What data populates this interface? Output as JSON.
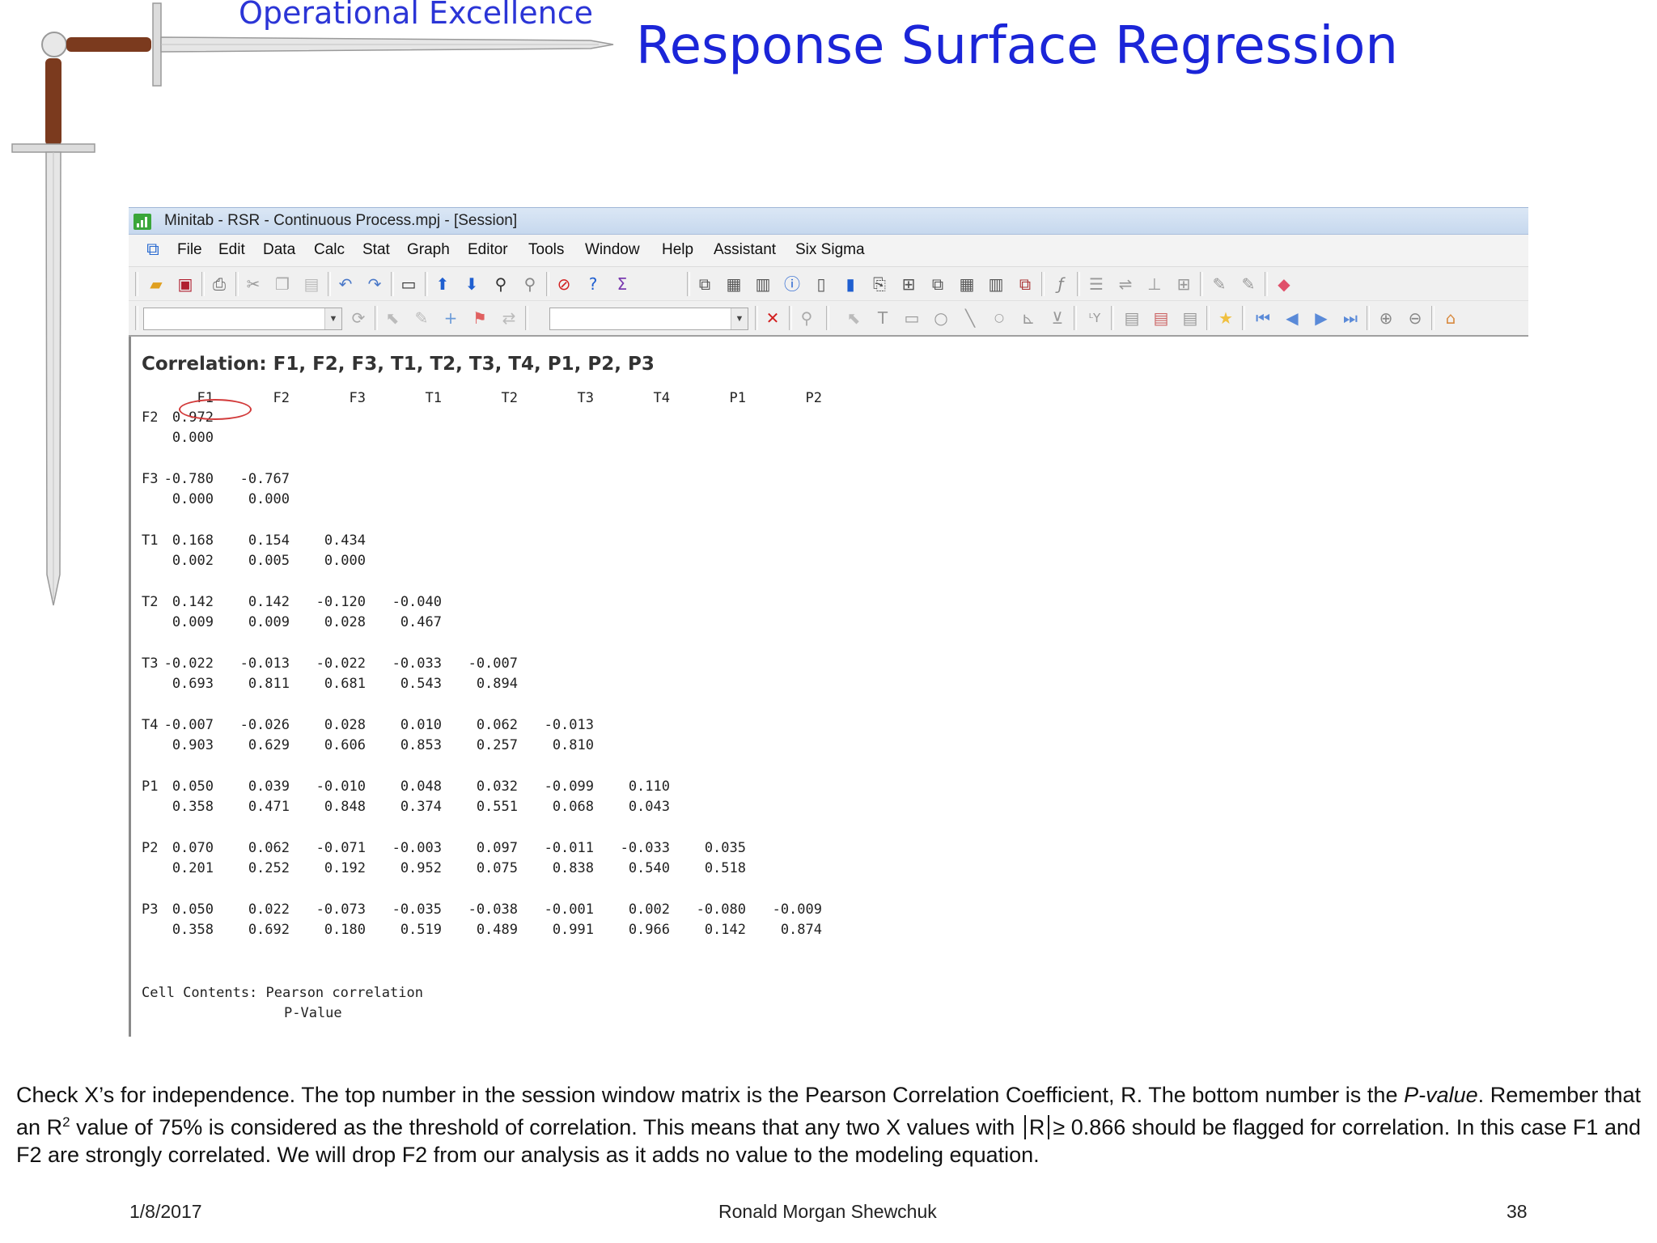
{
  "header": {
    "brand": "Operational Excellence",
    "title": "Response Surface Regression"
  },
  "window": {
    "title": "Minitab - RSR - Continuous Process.mpj - [Session]",
    "menu": [
      "File",
      "Edit",
      "Data",
      "Calc",
      "Stat",
      "Graph",
      "Editor",
      "Tools",
      "Window",
      "Help",
      "Assistant",
      "Six Sigma"
    ]
  },
  "session": {
    "heading": "Correlation: F1, F2, F3, T1, T2, T3, T4, P1, P2, P3",
    "columns": [
      "F1",
      "F2",
      "F3",
      "T1",
      "T2",
      "T3",
      "T4",
      "P1",
      "P2"
    ],
    "rows": [
      {
        "label": "F2",
        "r": [
          "0.972"
        ],
        "p": [
          "0.000"
        ]
      },
      {
        "label": "F3",
        "r": [
          "-0.780",
          "-0.767"
        ],
        "p": [
          "0.000",
          "0.000"
        ]
      },
      {
        "label": "T1",
        "r": [
          "0.168",
          "0.154",
          "0.434"
        ],
        "p": [
          "0.002",
          "0.005",
          "0.000"
        ]
      },
      {
        "label": "T2",
        "r": [
          "0.142",
          "0.142",
          "-0.120",
          "-0.040"
        ],
        "p": [
          "0.009",
          "0.009",
          "0.028",
          "0.467"
        ]
      },
      {
        "label": "T3",
        "r": [
          "-0.022",
          "-0.013",
          "-0.022",
          "-0.033",
          "-0.007"
        ],
        "p": [
          "0.693",
          "0.811",
          "0.681",
          "0.543",
          "0.894"
        ]
      },
      {
        "label": "T4",
        "r": [
          "-0.007",
          "-0.026",
          "0.028",
          "0.010",
          "0.062",
          "-0.013"
        ],
        "p": [
          "0.903",
          "0.629",
          "0.606",
          "0.853",
          "0.257",
          "0.810"
        ]
      },
      {
        "label": "P1",
        "r": [
          "0.050",
          "0.039",
          "-0.010",
          "0.048",
          "0.032",
          "-0.099",
          "0.110"
        ],
        "p": [
          "0.358",
          "0.471",
          "0.848",
          "0.374",
          "0.551",
          "0.068",
          "0.043"
        ]
      },
      {
        "label": "P2",
        "r": [
          "0.070",
          "0.062",
          "-0.071",
          "-0.003",
          "0.097",
          "-0.011",
          "-0.033",
          "0.035"
        ],
        "p": [
          "0.201",
          "0.252",
          "0.192",
          "0.952",
          "0.075",
          "0.838",
          "0.540",
          "0.518"
        ]
      },
      {
        "label": "P3",
        "r": [
          "0.050",
          "0.022",
          "-0.073",
          "-0.035",
          "-0.038",
          "-0.001",
          "0.002",
          "-0.080",
          "-0.009"
        ],
        "p": [
          "0.358",
          "0.692",
          "0.180",
          "0.519",
          "0.489",
          "0.991",
          "0.966",
          "0.142",
          "0.874"
        ]
      }
    ],
    "cell_contents_label": "Cell Contents: Pearson correlation",
    "cell_contents_line2": "P-Value",
    "highlighted_cell": "F2/F1 0.972"
  },
  "note": {
    "part1": "Check X’s for independence.  The top number in the session window matrix is the Pearson Correlation Coefficient, R.  The bottom number is the ",
    "italic1": "P-value",
    "part2": ".  Remember that an R",
    "sup": "2",
    "part3": " value of 75% is considered as the threshold of correlation.  This means that any two X values with ",
    "r_symbol": "R",
    "part4": "≥ 0.866 should be flagged for correlation.  In this case F1 and F2 are strongly correlated.  We will drop F2 from our analysis as it adds no value to the modeling equation."
  },
  "footer": {
    "date": "1/8/2017",
    "author": "Ronald Morgan Shewchuk",
    "page": "38"
  },
  "colors": {
    "title_blue": "#1b25d8",
    "highlight_red": "#d23a3a"
  }
}
